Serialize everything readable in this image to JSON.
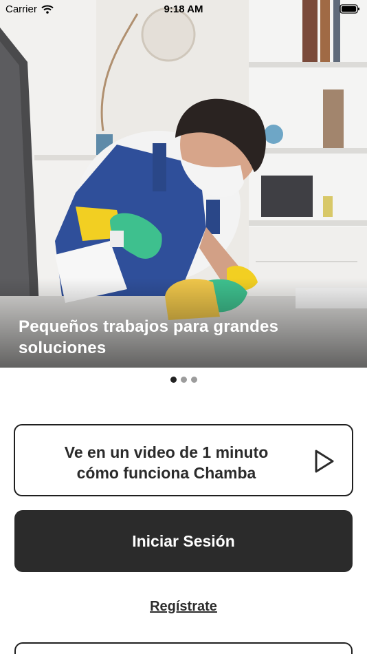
{
  "status_bar": {
    "carrier": "Carrier",
    "time": "9:18 AM",
    "icons": [
      "wifi-icon",
      "battery-icon"
    ]
  },
  "hero": {
    "caption": "Pequeños trabajos para grandes soluciones",
    "image": "woman-cleaning-table-photo"
  },
  "carousel": {
    "page_count": 3,
    "active_index": 0
  },
  "video_button": {
    "label_line1": "Ve en un video de 1 minuto",
    "label_line2": "cómo funciona Chamba",
    "icon": "play-icon"
  },
  "login_button": {
    "label": "Iniciar Sesión"
  },
  "register_link": {
    "label": "Regístrate"
  },
  "colors": {
    "primary_dark": "#2b2b2b",
    "background": "#ffffff",
    "dot_inactive": "#9c9c9c",
    "dot_active": "#222222"
  }
}
